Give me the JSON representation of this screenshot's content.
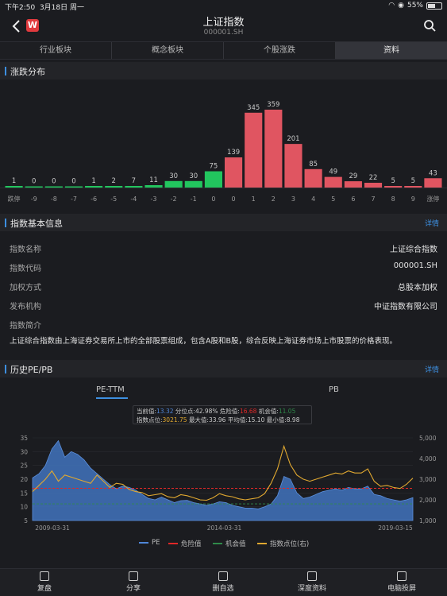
{
  "status": {
    "time": "下午2:50",
    "date": "3月18日 周一",
    "battery": "55%",
    "battery_level": 0.55
  },
  "nav": {
    "title": "上证指数",
    "code": "000001.SH",
    "logo_text": "W"
  },
  "tabs": [
    "行业板块",
    "概念板块",
    "个股涨跌",
    "资料"
  ],
  "active_tab": 3,
  "distribution": {
    "title": "涨跌分布",
    "chart_data": {
      "type": "bar",
      "categories": [
        "跌停",
        "-9",
        "-8",
        "-7",
        "-6",
        "-5",
        "-4",
        "-3",
        "-2",
        "-1",
        "0",
        "0",
        "1",
        "2",
        "3",
        "4",
        "5",
        "6",
        "7",
        "8",
        "9",
        "涨停"
      ],
      "values": [
        1,
        0,
        0,
        0,
        1,
        2,
        7,
        11,
        30,
        30,
        75,
        139,
        345,
        359,
        201,
        85,
        49,
        29,
        22,
        5,
        5,
        43
      ],
      "colors": [
        "#22c55e",
        "#22c55e",
        "#22c55e",
        "#22c55e",
        "#22c55e",
        "#22c55e",
        "#22c55e",
        "#22c55e",
        "#22c55e",
        "#22c55e",
        "#22c55e",
        "#e05561",
        "#e05561",
        "#e05561",
        "#e05561",
        "#e05561",
        "#e05561",
        "#e05561",
        "#e05561",
        "#e05561",
        "#e05561",
        "#e05561"
      ]
    }
  },
  "info": {
    "title": "指数基本信息",
    "more": "详情",
    "rows": [
      {
        "k": "指数名称",
        "v": "上证综合指数"
      },
      {
        "k": "指数代码",
        "v": "000001.SH"
      },
      {
        "k": "加权方式",
        "v": "总股本加权"
      },
      {
        "k": "发布机构",
        "v": "中证指数有限公司"
      },
      {
        "k": "指数简介",
        "v": ""
      }
    ],
    "intro": "上证综合指数由上海证券交易所上市的全部股票组成，包含A股和B股，综合反映上海证券市场上市股票的价格表现。"
  },
  "history": {
    "title": "历史PE/PB",
    "more": "详情",
    "tabs": [
      "PE-TTM",
      "PB"
    ],
    "stats": {
      "cur_label": "当前值:",
      "cur": "13.32",
      "pct_label": "分位点:",
      "pct": "42.98%",
      "danger_label": "危险值:",
      "danger": "16.68",
      "chance_label": "机会值:",
      "chance": "11.05",
      "idx_label": "指数点位:",
      "idx": "3021.75",
      "max_label": "最大值:",
      "max": "33.96",
      "avg_label": "平均值:",
      "avg": "15.10",
      "min_label": "最小值:",
      "min": "8.98"
    },
    "chart_data": {
      "type": "area",
      "x_ticks": [
        "2009-03-31",
        "2014-03-31",
        "2019-03-15"
      ],
      "y_left_ticks": [
        "35",
        "30",
        "25",
        "20",
        "15",
        "10",
        "5"
      ],
      "y_right_ticks": [
        "5,000",
        "4,000",
        "3,000",
        "2,000",
        "1,000"
      ],
      "ylim_left": [
        5,
        35
      ],
      "ylim_right": [
        1000,
        5000
      ],
      "danger": 16.68,
      "chance": 11.05,
      "pe": [
        20.5,
        22,
        25,
        31,
        34,
        28,
        30,
        29,
        27,
        24,
        22,
        20,
        18,
        16.5,
        17.5,
        17,
        16,
        14.5,
        13,
        12.5,
        13.5,
        12.5,
        11.5,
        12.2,
        12.3,
        11.5,
        11,
        10.5,
        11,
        11.8,
        11.5,
        10.5,
        10,
        9.5,
        9.5,
        9.2,
        10,
        11,
        14,
        21,
        20,
        15,
        13,
        13.5,
        14.5,
        15.5,
        16,
        16.5,
        16,
        17,
        16.5,
        16.5,
        17.5,
        14.5,
        14,
        13,
        12.5,
        12,
        12.5,
        13.3
      ],
      "index": [
        2400,
        2700,
        3000,
        3400,
        2900,
        3200,
        3100,
        3000,
        2900,
        2800,
        3200,
        2900,
        2600,
        2800,
        2750,
        2500,
        2400,
        2350,
        2200,
        2250,
        2300,
        2150,
        2100,
        2250,
        2200,
        2100,
        2000,
        1980,
        2100,
        2300,
        2200,
        2150,
        2050,
        2000,
        2050,
        2100,
        2300,
        2800,
        3500,
        4600,
        3700,
        3200,
        3000,
        2900,
        3000,
        3100,
        3200,
        3300,
        3250,
        3400,
        3300,
        3300,
        3500,
        2900,
        2650,
        2700,
        2600,
        2550,
        2750,
        3050
      ],
      "legend": [
        "PE",
        "危险值",
        "机会值",
        "指数点位(右)"
      ],
      "legend_colors": [
        "#4f86d8",
        "#e02828",
        "#2f8a4a",
        "#e0a830"
      ]
    }
  },
  "bottom_bar": [
    "复盘",
    "分享",
    "删自选",
    "深度资料",
    "电脑投屏"
  ]
}
